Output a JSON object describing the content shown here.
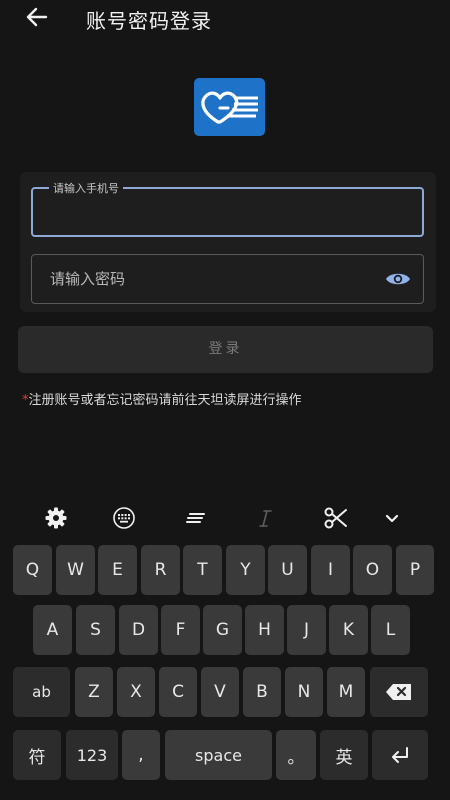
{
  "header": {
    "title": "账号密码登录",
    "back_icon": "arrow-left-icon"
  },
  "logo": {
    "icon": "heart-document-logo",
    "color": "#1e73c8"
  },
  "form": {
    "phone_label": "请输入手机号",
    "phone_value": "",
    "password_placeholder": "请输入密码",
    "password_value": "",
    "toggle_icon": "eye-icon",
    "accent_color": "#8fa9d6"
  },
  "login_button": {
    "label": "登录"
  },
  "notice": {
    "star": "*",
    "text": "注册账号或者忘记密码请前往天坦读屏进行操作",
    "star_color": "#e03b3b"
  },
  "keyboard": {
    "toolbar": [
      "gear-icon",
      "keyboard-icon",
      "text-align-icon",
      "italic-icon",
      "scissors-icon",
      "chevron-down-icon"
    ],
    "row1": [
      "Q",
      "W",
      "E",
      "R",
      "T",
      "Y",
      "U",
      "I",
      "O",
      "P"
    ],
    "row2": [
      "A",
      "S",
      "D",
      "F",
      "G",
      "H",
      "J",
      "K",
      "L"
    ],
    "row3": [
      "ab",
      "Z",
      "X",
      "C",
      "V",
      "B",
      "N",
      "M"
    ],
    "backspace_icon": "backspace-icon",
    "row4": {
      "symbols": "符",
      "numbers": "123",
      "comma": ",",
      "space": "space",
      "period": "。",
      "lang": "英"
    },
    "enter_icon": "enter-icon"
  }
}
